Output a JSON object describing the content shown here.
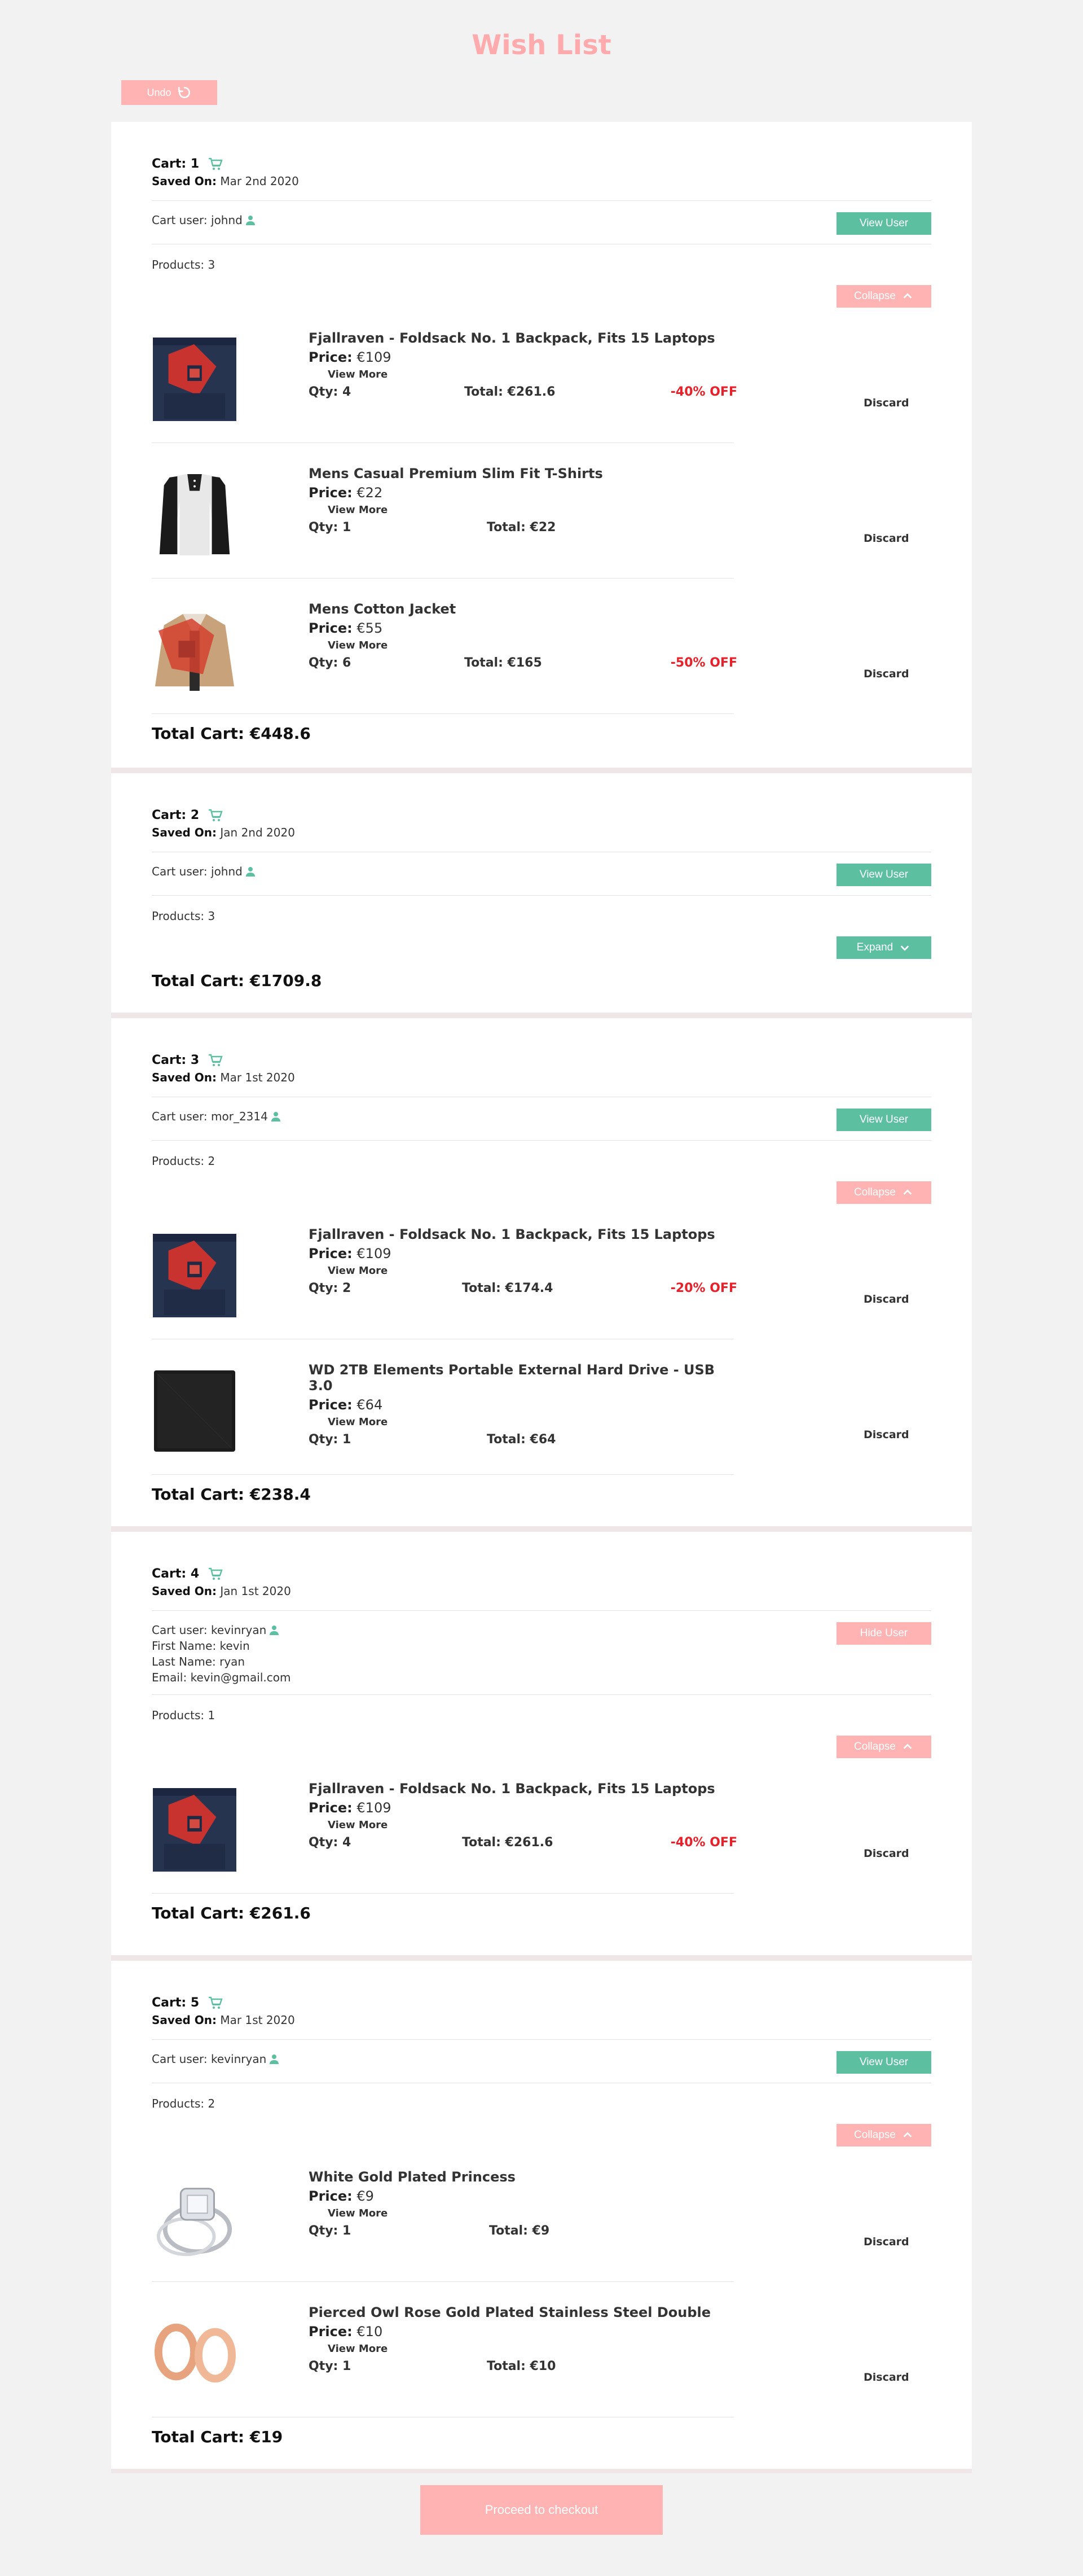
{
  "page": {
    "title": "Wish List",
    "undo_label": "Undo",
    "checkout_label": "Proceed to checkout"
  },
  "labels": {
    "saved_on": "Saved On:",
    "cart_user": "Cart user:",
    "price": "Price:",
    "view_more": "View More",
    "discard": "Discard"
  },
  "colors": {
    "accent_pink": "#ffb3b3",
    "title_pink": "#ffaaad",
    "green": "#5cbf9f",
    "discount_red": "#e8202a"
  },
  "carts": [
    {
      "title": "Cart: 1",
      "saved_on": "Mar 2nd 2020",
      "user": "johnd",
      "user_button": "View User",
      "products_label": "Products: 3",
      "toggle_label": "Collapse",
      "total": "Total Cart: €448.6",
      "products": [
        {
          "name": "Fjallraven - Foldsack No. 1 Backpack, Fits 15 Laptops",
          "price": "€109",
          "qty": "Qty: 4",
          "total": "Total: €261.6",
          "off": "-40% OFF",
          "image": "backpack"
        },
        {
          "name": "Mens Casual Premium Slim Fit T-Shirts",
          "price": "€22",
          "qty": "Qty: 1",
          "total": "Total: €22",
          "off": "",
          "image": "tshirt"
        },
        {
          "name": "Mens Cotton Jacket",
          "price": "€55",
          "qty": "Qty: 6",
          "total": "Total: €165",
          "off": "-50% OFF",
          "image": "jacket"
        }
      ]
    },
    {
      "title": "Cart: 2",
      "saved_on": "Jan 2nd 2020",
      "user": "johnd",
      "user_button": "View User",
      "products_label": "Products: 3",
      "toggle_label": "Expand",
      "total": "Total Cart: €1709.8"
    },
    {
      "title": "Cart: 3",
      "saved_on": "Mar 1st 2020",
      "user": "mor_2314",
      "user_button": "View User",
      "products_label": "Products: 2",
      "toggle_label": "Collapse",
      "total": "Total Cart: €238.4",
      "products": [
        {
          "name": "Fjallraven - Foldsack No. 1 Backpack, Fits 15 Laptops",
          "price": "€109",
          "qty": "Qty: 2",
          "total": "Total: €174.4",
          "off": "-20% OFF",
          "image": "backpack"
        },
        {
          "name": "WD 2TB Elements Portable External Hard Drive - USB 3.0",
          "price": "€64",
          "qty": "Qty: 1",
          "total": "Total: €64",
          "off": "",
          "image": "harddrive"
        }
      ]
    },
    {
      "title": "Cart: 4",
      "saved_on": "Jan 1st 2020",
      "user": "kevinryan",
      "first_name": "First Name: kevin",
      "last_name": "Last Name: ryan",
      "email": "Email: kevin@gmail.com",
      "user_button": "Hide User",
      "products_label": "Products: 1",
      "toggle_label": "Collapse",
      "total": "Total Cart: €261.6",
      "products": [
        {
          "name": "Fjallraven - Foldsack No. 1 Backpack, Fits 15 Laptops",
          "price": "€109",
          "qty": "Qty: 4",
          "total": "Total: €261.6",
          "off": "-40% OFF",
          "image": "backpack"
        }
      ]
    },
    {
      "title": "Cart: 5",
      "saved_on": "Mar 1st 2020",
      "user": "kevinryan",
      "user_button": "View User",
      "products_label": "Products: 2",
      "toggle_label": "Collapse",
      "total": "Total Cart: €19",
      "products": [
        {
          "name": "White Gold Plated Princess",
          "price": "€9",
          "qty": "Qty: 1",
          "total": "Total: €9",
          "off": "",
          "image": "ring"
        },
        {
          "name": "Pierced Owl Rose Gold Plated Stainless Steel Double",
          "price": "€10",
          "qty": "Qty: 1",
          "total": "Total: €10",
          "off": "",
          "image": "rosegold"
        }
      ]
    }
  ]
}
